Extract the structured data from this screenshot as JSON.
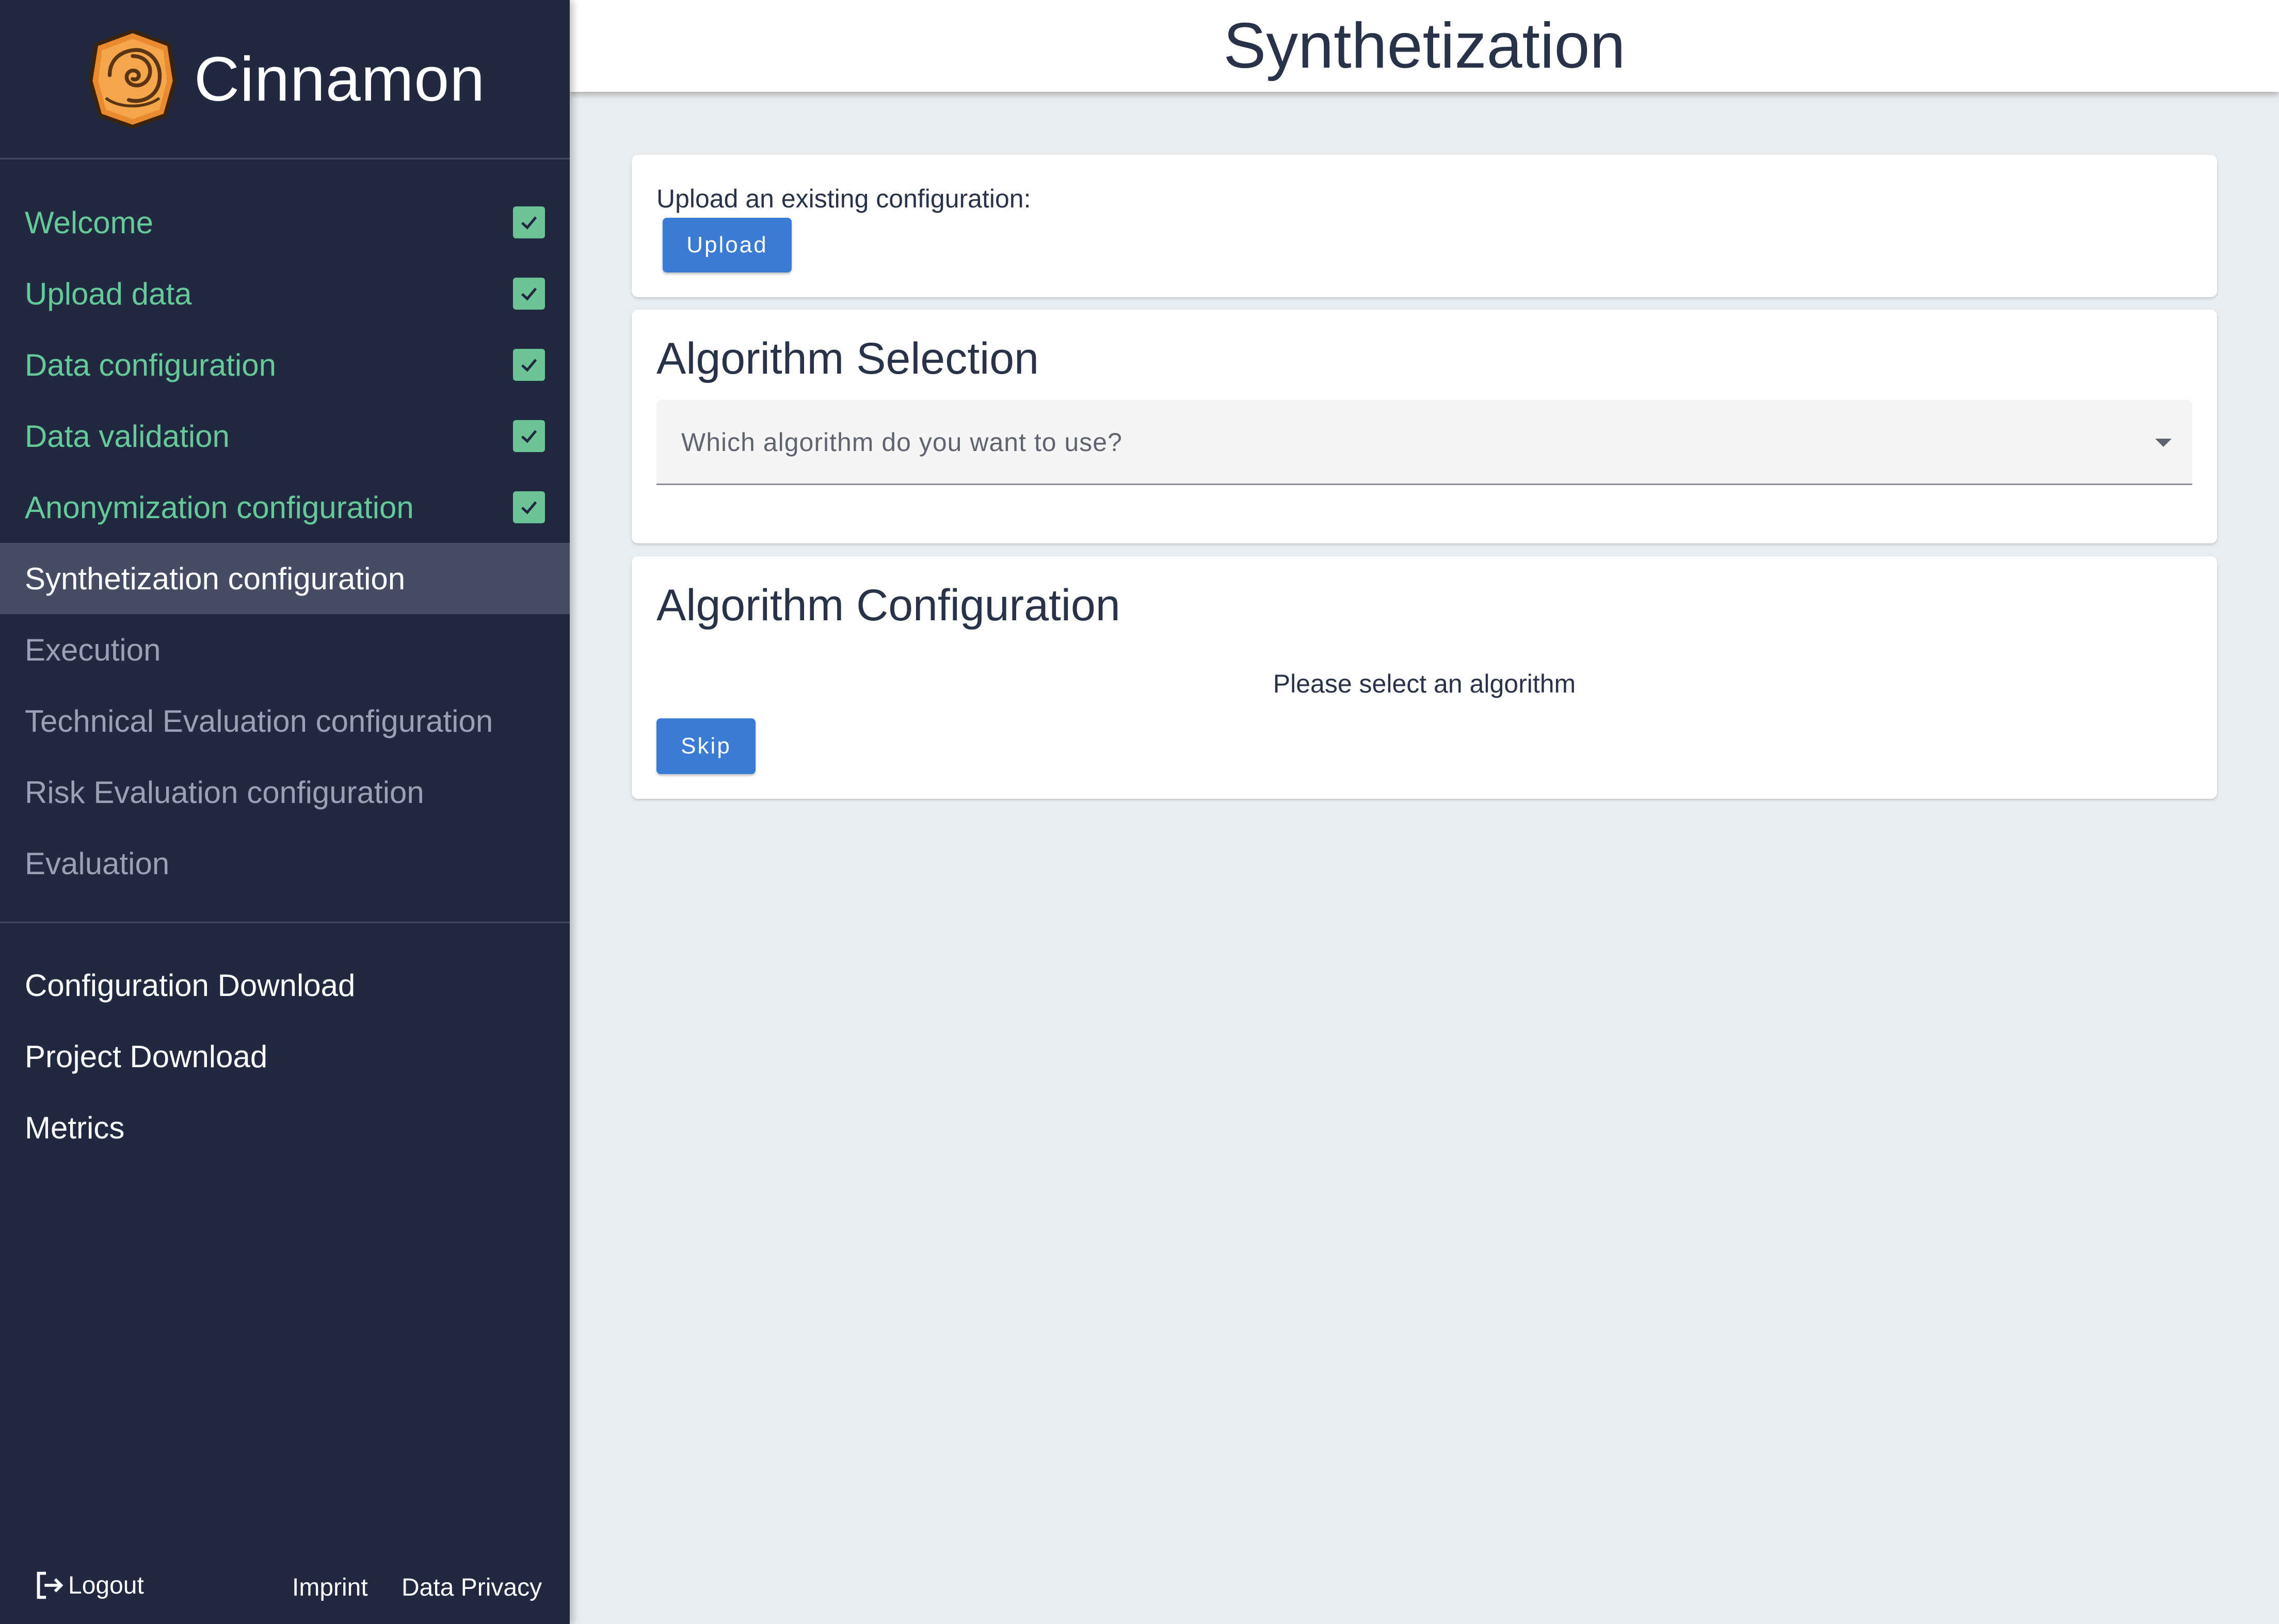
{
  "brand": {
    "name": "Cinnamon",
    "logo_icon": "cinnamon-roll-icon",
    "accent": "#e98a2f"
  },
  "sidebar": {
    "steps": [
      {
        "label": "Welcome",
        "state": "done"
      },
      {
        "label": "Upload data",
        "state": "done"
      },
      {
        "label": "Data configuration",
        "state": "done"
      },
      {
        "label": "Data validation",
        "state": "done"
      },
      {
        "label": "Anonymization configuration",
        "state": "done"
      },
      {
        "label": "Synthetization configuration",
        "state": "active"
      },
      {
        "label": "Execution",
        "state": "pending"
      },
      {
        "label": "Technical Evaluation configuration",
        "state": "pending"
      },
      {
        "label": "Risk Evaluation configuration",
        "state": "pending"
      },
      {
        "label": "Evaluation",
        "state": "pending"
      }
    ],
    "links": [
      {
        "label": "Configuration Download"
      },
      {
        "label": "Project Download"
      },
      {
        "label": "Metrics"
      }
    ],
    "footer": {
      "logout": "Logout",
      "imprint": "Imprint",
      "privacy": "Data Privacy"
    },
    "colors": {
      "background": "#212940",
      "done": "#66c99a",
      "active_bg": "#454c63",
      "pending": "#9aa1b3"
    }
  },
  "header": {
    "title": "Synthetization"
  },
  "upload_card": {
    "label": "Upload an existing configuration:",
    "button": "Upload"
  },
  "selection_card": {
    "title": "Algorithm Selection",
    "placeholder": "Which algorithm do you want to use?"
  },
  "config_card": {
    "title": "Algorithm Configuration",
    "message": "Please select an algorithm",
    "button": "Skip"
  },
  "colors": {
    "primary_button": "#3a7bd5",
    "page_background": "#eaedf0",
    "text": "#28334a"
  }
}
